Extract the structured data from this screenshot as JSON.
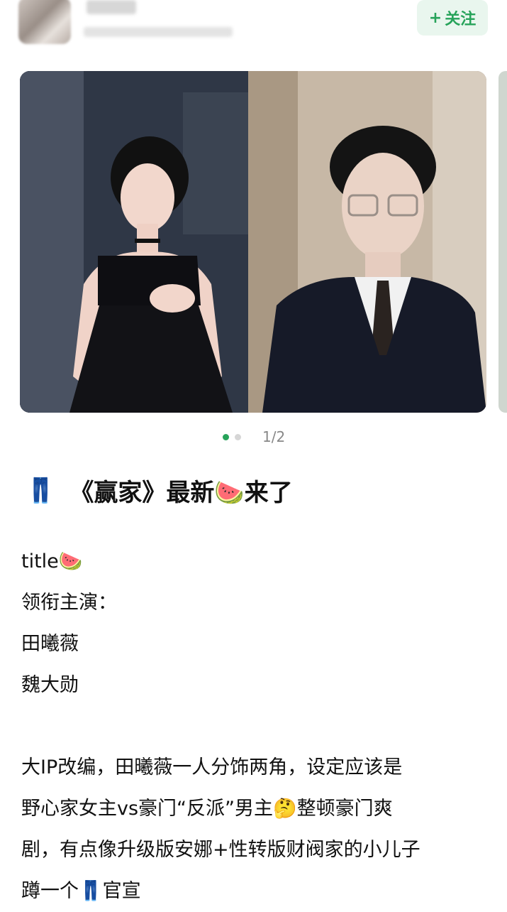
{
  "header": {
    "follow_label": "关注",
    "follow_icon": "plus-icon"
  },
  "carousel": {
    "pager": "1/2",
    "current_index": 1,
    "total": 2
  },
  "post": {
    "title_icon": "👖",
    "title_text": "《赢家》最新🍉来了",
    "lines": [
      "title🍉",
      "领衔主演：",
      "田曦薇",
      "魏大勋",
      "",
      "大IP改编，田曦薇一人分饰两角，设定应该是",
      "野心家女主vs豪门“反派”男主🤔整顿豪门爽",
      "剧，有点像升级版安娜+性转版财阀家的小儿子",
      "蹲一个👖官宣"
    ]
  },
  "colors": {
    "accent": "#27a35a",
    "follow_bg": "#e9f6ee"
  }
}
